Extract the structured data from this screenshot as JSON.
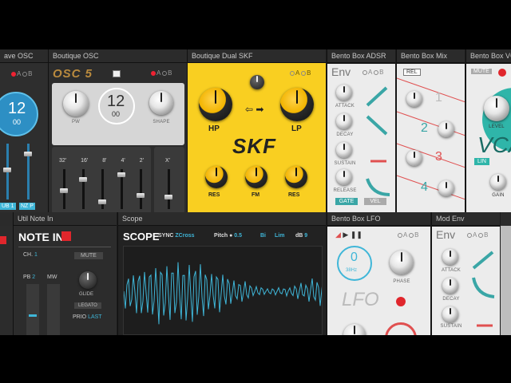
{
  "panels": {
    "wave_osc": {
      "header": "ave OSC",
      "value": "12",
      "sub": "00",
      "tag1": "UB 1",
      "tag2": "NZ P"
    },
    "boutique_osc": {
      "header": "Boutique OSC",
      "logo": "OSC 5",
      "ab_a": "A",
      "ab_b": "B",
      "value": "12",
      "sub": "00",
      "pw": "PW",
      "shape": "SHAPE",
      "footages": [
        "32'",
        "16'",
        "8'",
        "4'",
        "2'"
      ],
      "xmod": "X'"
    },
    "skf": {
      "header": "Boutique Dual SKF",
      "ab_a": "A",
      "ab_b": "B",
      "name": "SKF",
      "hp": "HP",
      "lp": "LP",
      "res1": "RES",
      "fm": "FM",
      "res2": "RES",
      "arrows": "⇦ ➡"
    },
    "adsr": {
      "header": "Bento Box ADSR",
      "title": "Env",
      "ab_a": "A",
      "ab_b": "B",
      "attack": "ATTACK",
      "decay": "DECAY",
      "sustain": "SUSTAIN",
      "release": "RELEASE",
      "gate": "GATE",
      "vel": "VEL"
    },
    "mix": {
      "header": "Bento Box Mix",
      "rel": "REL",
      "n1": "1",
      "n2": "2",
      "n3": "3",
      "n4": "4"
    },
    "vca": {
      "header": "Bento Box VC",
      "mute": "MUTE",
      "title": "VCA",
      "level": "LEVEL",
      "lin": "LIN",
      "gain": "GAIN"
    },
    "util": {
      "header": "Util Note In",
      "title": "NOTE IN",
      "ch_label": "CH.",
      "ch_value": "1",
      "mute": "MUTE",
      "pb_label": "PB",
      "pb_value": "2",
      "mw": "MW",
      "glide": "GLIDE",
      "legato": "LEGATO",
      "prio_label": "PRIO",
      "prio_value": "LAST"
    },
    "scope": {
      "header": "Scope",
      "title": "SCOPE",
      "sync_label": "SYNC",
      "sync_value": "ZCross",
      "pitch_label": "Pitch",
      "pitch_value": "0.5",
      "bi": "Bi",
      "lim": "Lim",
      "db_label": "dB",
      "db_value": "9"
    },
    "lfo": {
      "header": "Bento Box LFO",
      "ab_a": "A",
      "ab_b": "B",
      "rate": "0",
      "rate_sub": "38Hz",
      "title": "LFO",
      "phase": "PHASE"
    },
    "modenv": {
      "header": "Mod Env",
      "title": "Env",
      "ab_a": "A",
      "ab_b": "B",
      "attack": "ATTACK",
      "decay": "DECAY",
      "sustain": "SUSTAIN"
    }
  },
  "colors": {
    "accent_cyan": "#3fb6d8",
    "skf_yellow": "#f9cf21",
    "adsr_teal": "#3aa6a6",
    "note_red": "#e0262c",
    "mix_red": "#e05050",
    "vca_teal": "#2fb5a9"
  }
}
